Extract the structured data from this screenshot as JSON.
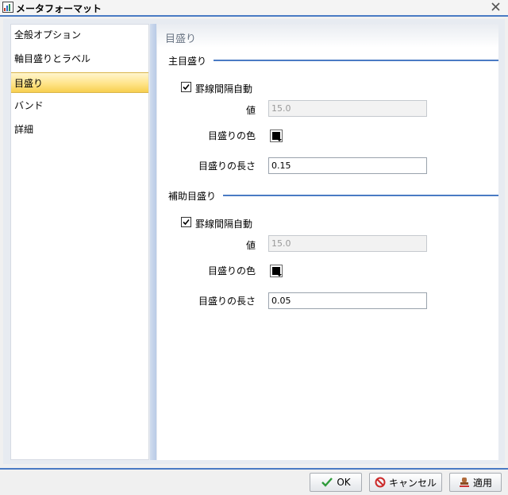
{
  "window": {
    "title": "メータフォーマット"
  },
  "nav": {
    "items": [
      {
        "label": "全般オプション"
      },
      {
        "label": "軸目盛りとラベル"
      },
      {
        "label": "目盛り",
        "selected": true
      },
      {
        "label": "バンド"
      },
      {
        "label": "詳細"
      }
    ]
  },
  "panel": {
    "header": "目盛り",
    "major": {
      "section_title": "主目盛り",
      "auto_interval_label": "罫線間隔自動",
      "auto_interval_checked": true,
      "value_label": "値",
      "value": "15.0",
      "color_label": "目盛りの色",
      "color": "#000000",
      "length_label": "目盛りの長さ",
      "length": "0.15"
    },
    "minor": {
      "section_title": "補助目盛り",
      "auto_interval_label": "罫線間隔自動",
      "auto_interval_checked": true,
      "value_label": "値",
      "value": "15.0",
      "color_label": "目盛りの色",
      "color": "#000000",
      "length_label": "目盛りの長さ",
      "length": "0.05"
    }
  },
  "buttons": {
    "ok": "OK",
    "cancel": "キャンセル",
    "apply": "適用"
  },
  "colors": {
    "accent": "#4a7bc4",
    "selection": "#ffe48a"
  }
}
